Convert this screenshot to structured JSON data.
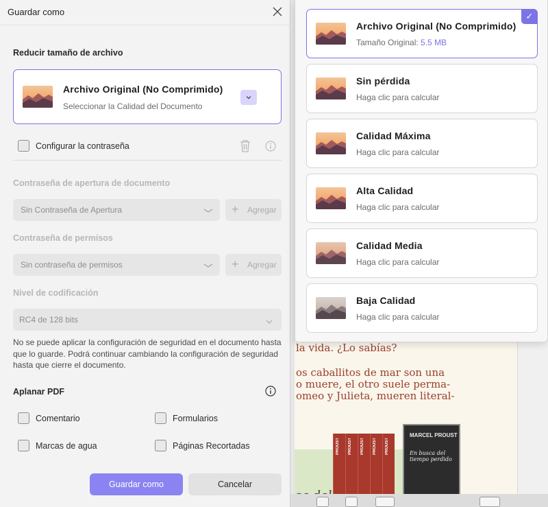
{
  "dialog": {
    "title": "Guardar como",
    "reduce_section": "Reducir tamaño de archivo",
    "quality_card": {
      "title": "Archivo Original (No Comprimido)",
      "subtitle": "Seleccionar la Calidad del Documento"
    },
    "password_checkbox": "Configurar la contraseña",
    "open_password": {
      "label": "Contraseña de apertura de documento",
      "value": "Sin Contraseña de Apertura",
      "add_label": "Agregar"
    },
    "permission_password": {
      "label": "Contraseña de permisos",
      "value": "Sin contraseña de permisos",
      "add_label": "Agregar"
    },
    "encryption": {
      "label": "Nivel de codificación",
      "value": "RC4 de 128 bits"
    },
    "security_note": "No se puede aplicar la configuración de seguridad en el documento hasta que lo guarde. Podrá continuar cambiando la configuración de seguridad hasta que cierre el documento.",
    "flatten_section": "Aplanar PDF",
    "flatten_options": {
      "comment": "Comentario",
      "forms": "Formularios",
      "watermarks": "Marcas de agua",
      "cropped_pages": "Páginas Recortadas"
    },
    "save_button": "Guardar como",
    "cancel_button": "Cancelar"
  },
  "quality_options": [
    {
      "title": "Archivo Original (No Comprimido)",
      "subtitle_prefix": "Tamaño Original: ",
      "size": "5.5 MB",
      "selected": true
    },
    {
      "title": "Sin pérdida",
      "subtitle": "Haga clic para calcular"
    },
    {
      "title": "Calidad Máxima",
      "subtitle": "Haga clic para calcular"
    },
    {
      "title": "Alta Calidad",
      "subtitle": "Haga clic para calcular"
    },
    {
      "title": "Calidad Media",
      "subtitle": "Haga clic para calcular"
    },
    {
      "title": "Baja Calidad",
      "subtitle": "Haga clic para calcular"
    }
  ],
  "background_document": {
    "lines": [
      "la vida. ¿Lo sabías?",
      "os caballitos de mar son una",
      "o muere, el otro suele perma-",
      "omeo y Julieta, mueren literal-"
    ],
    "italic_fragment": "ca del",
    "book_spine": "PROUST",
    "book_cover_author": "MARCEL PROUST",
    "book_cover_title": "En busca del tiempo perdido"
  },
  "colors": {
    "accent": "#7b73e6",
    "primary_button": "#8a83f1",
    "dropdown_toggle": "#d9d4fb"
  },
  "icons": [
    "close-icon",
    "chevron-down-icon",
    "trash-icon",
    "info-icon",
    "plus-icon",
    "check-icon",
    "landscape-thumbnail-icon"
  ]
}
